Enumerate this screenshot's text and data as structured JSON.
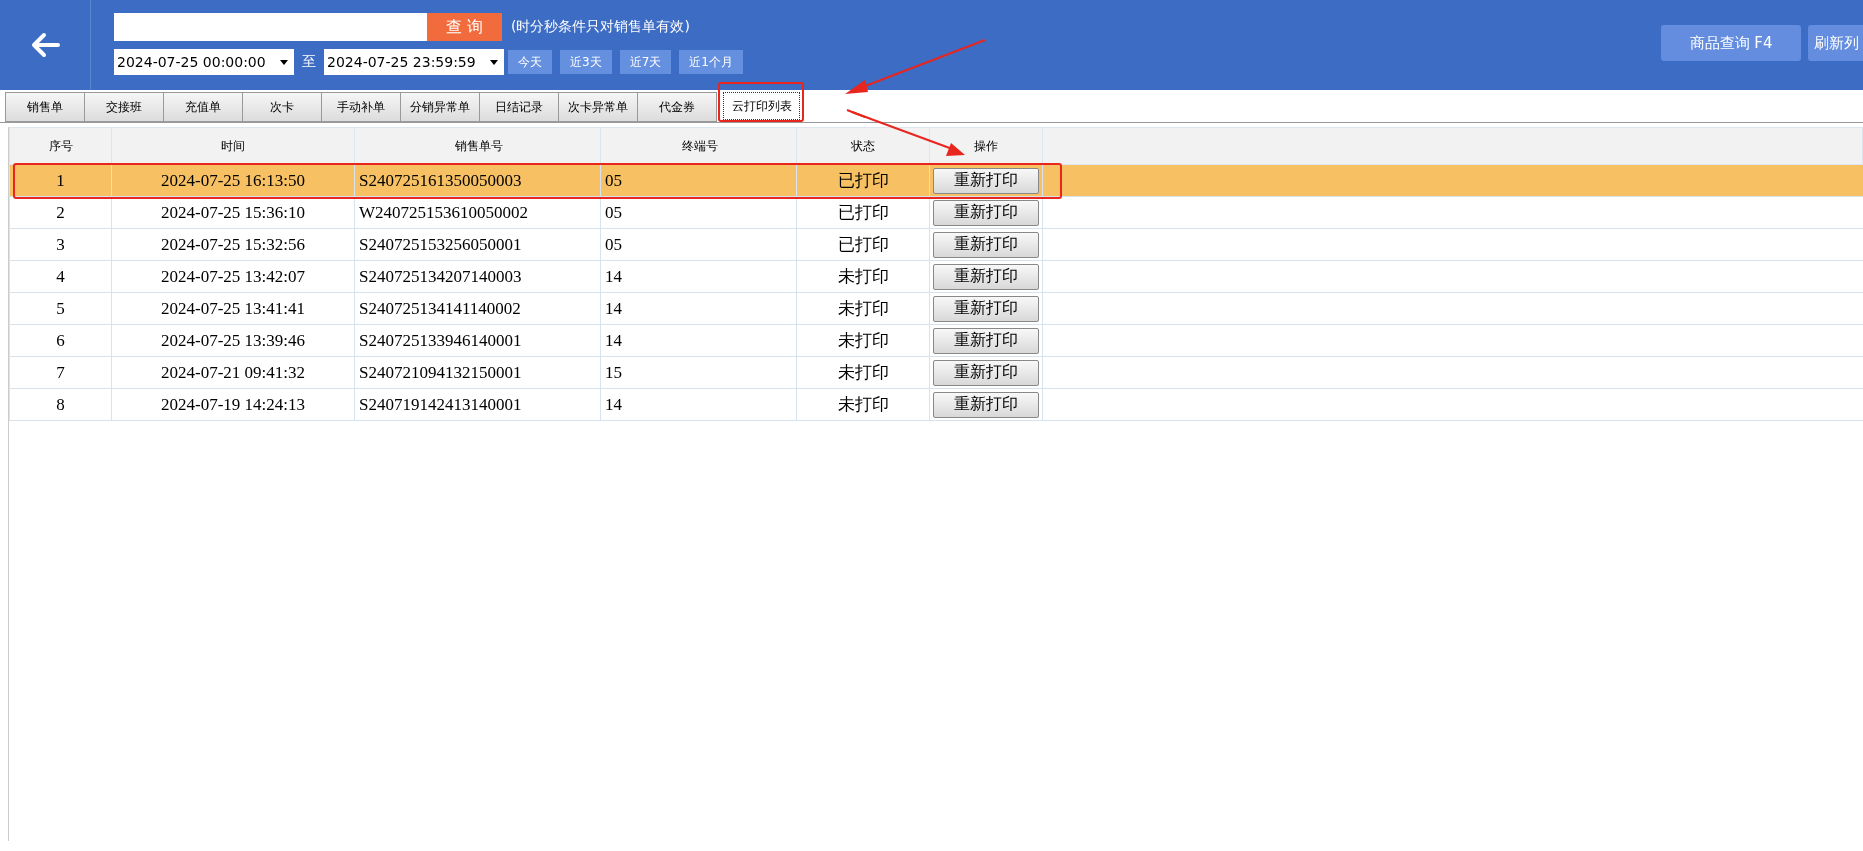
{
  "header": {
    "query_button": "查 询",
    "hint": "(时分秒条件只对销售单有效)",
    "date_from": "2024-07-25 00:00:00",
    "date_separator": "至",
    "date_to": "2024-07-25 23:59:59",
    "quick_ranges": [
      {
        "label": "今天"
      },
      {
        "label": "近3天"
      },
      {
        "label": "近7天"
      },
      {
        "label": "近1个月"
      }
    ],
    "right_buttons": [
      {
        "label": "商品查询 F4"
      },
      {
        "label": "刷新列"
      }
    ]
  },
  "tabs": [
    {
      "label": "销售单",
      "selected": false,
      "highlighted": false
    },
    {
      "label": "交接班",
      "selected": false,
      "highlighted": false
    },
    {
      "label": "充值单",
      "selected": false,
      "highlighted": false
    },
    {
      "label": "次卡",
      "selected": false,
      "highlighted": false
    },
    {
      "label": "手动补单",
      "selected": false,
      "highlighted": false
    },
    {
      "label": "分销异常单",
      "selected": false,
      "highlighted": false
    },
    {
      "label": "日结记录",
      "selected": false,
      "highlighted": false
    },
    {
      "label": "次卡异常单",
      "selected": false,
      "highlighted": false
    },
    {
      "label": "代金券",
      "selected": false,
      "highlighted": false
    },
    {
      "label": "云打印列表",
      "selected": true,
      "highlighted": true
    }
  ],
  "table": {
    "columns": [
      "序号",
      "时间",
      "销售单号",
      "终端号",
      "状态",
      "操作"
    ],
    "rows": [
      {
        "index": "1",
        "time": "2024-07-25 16:13:50",
        "order_no": "S240725161350050003",
        "terminal": "05",
        "status": "已打印",
        "action": "重新打印",
        "selected": true,
        "highlighted": true
      },
      {
        "index": "2",
        "time": "2024-07-25 15:36:10",
        "order_no": "W240725153610050002",
        "terminal": "05",
        "status": "已打印",
        "action": "重新打印",
        "selected": false,
        "highlighted": false
      },
      {
        "index": "3",
        "time": "2024-07-25 15:32:56",
        "order_no": "S240725153256050001",
        "terminal": "05",
        "status": "已打印",
        "action": "重新打印",
        "selected": false,
        "highlighted": false
      },
      {
        "index": "4",
        "time": "2024-07-25 13:42:07",
        "order_no": "S240725134207140003",
        "terminal": "14",
        "status": "未打印",
        "action": "重新打印",
        "selected": false,
        "highlighted": false
      },
      {
        "index": "5",
        "time": "2024-07-25 13:41:41",
        "order_no": "S240725134141140002",
        "terminal": "14",
        "status": "未打印",
        "action": "重新打印",
        "selected": false,
        "highlighted": false
      },
      {
        "index": "6",
        "time": "2024-07-25 13:39:46",
        "order_no": "S240725133946140001",
        "terminal": "14",
        "status": "未打印",
        "action": "重新打印",
        "selected": false,
        "highlighted": false
      },
      {
        "index": "7",
        "time": "2024-07-21 09:41:32",
        "order_no": "S240721094132150001",
        "terminal": "15",
        "status": "未打印",
        "action": "重新打印",
        "selected": false,
        "highlighted": false
      },
      {
        "index": "8",
        "time": "2024-07-19 14:24:13",
        "order_no": "S240719142413140001",
        "terminal": "14",
        "status": "未打印",
        "action": "重新打印",
        "selected": false,
        "highlighted": false
      }
    ]
  }
}
